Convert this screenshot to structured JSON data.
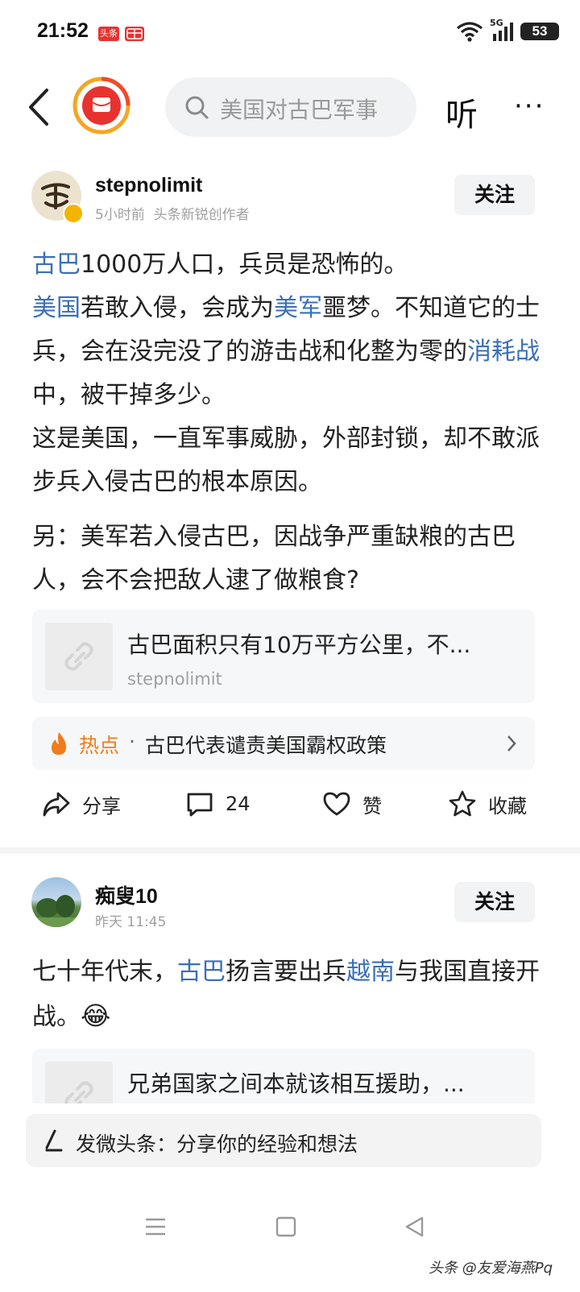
{
  "status": {
    "time": "21:52",
    "app_badge_1": "头条",
    "battery": "53",
    "network": "5G"
  },
  "nav": {
    "search_placeholder": "美国对古巴军事",
    "listen_label": "听",
    "more_label": "···"
  },
  "post1": {
    "username": "stepnolimit",
    "time": "5小时前",
    "role": "头条新锐创作者",
    "follow": "关注",
    "p1": [
      {
        "t": "古巴",
        "link": true
      },
      {
        "t": "1000万人口，兵员是恐怖的。",
        "link": false
      }
    ],
    "p2": [
      {
        "t": "美国",
        "link": true
      },
      {
        "t": "若敢入侵，会成为",
        "link": false
      },
      {
        "t": "美军",
        "link": true
      },
      {
        "t": "噩梦。不知道它的士兵，会在没完没了的游击战和化整为零的",
        "link": false
      },
      {
        "t": "消耗战",
        "link": true
      },
      {
        "t": "中，被干掉多少。",
        "link": false
      }
    ],
    "p3": "这是美国，一直军事威胁，外部封锁，却不敢派步兵入侵古巴的根本原因。",
    "p4": "另：美军若入侵古巴，因战争严重缺粮的古巴人，会不会把敌人逮了做粮食?",
    "card_title": "古巴面积只有10万平方公里，不...",
    "card_source": "stepnolimit",
    "hot_label": "热点",
    "hot_dot": "·",
    "hot_text": "古巴代表谴责美国霸权政策",
    "share": "分享",
    "comments": "24",
    "like": "赞",
    "collect": "收藏"
  },
  "post2": {
    "username": "痴叟10",
    "time": "昨天  11:45",
    "follow": "关注",
    "p1": [
      {
        "t": "七十年代末，",
        "link": false
      },
      {
        "t": "古巴",
        "link": true
      },
      {
        "t": "扬言要出兵",
        "link": false
      },
      {
        "t": "越南",
        "link": true
      },
      {
        "t": "与我国直接开战。",
        "link": false
      }
    ],
    "emoji": "😂",
    "card_title": "兄弟国家之间本就该相互援助，..."
  },
  "compose": {
    "placeholder": "发微头条：分享你的经验和想法"
  },
  "watermark": "头条 @友爱海燕Pq",
  "colors": {
    "link": "#3a6fb8",
    "accent_red": "#e8322f",
    "hot_orange": "#f07c1a"
  }
}
